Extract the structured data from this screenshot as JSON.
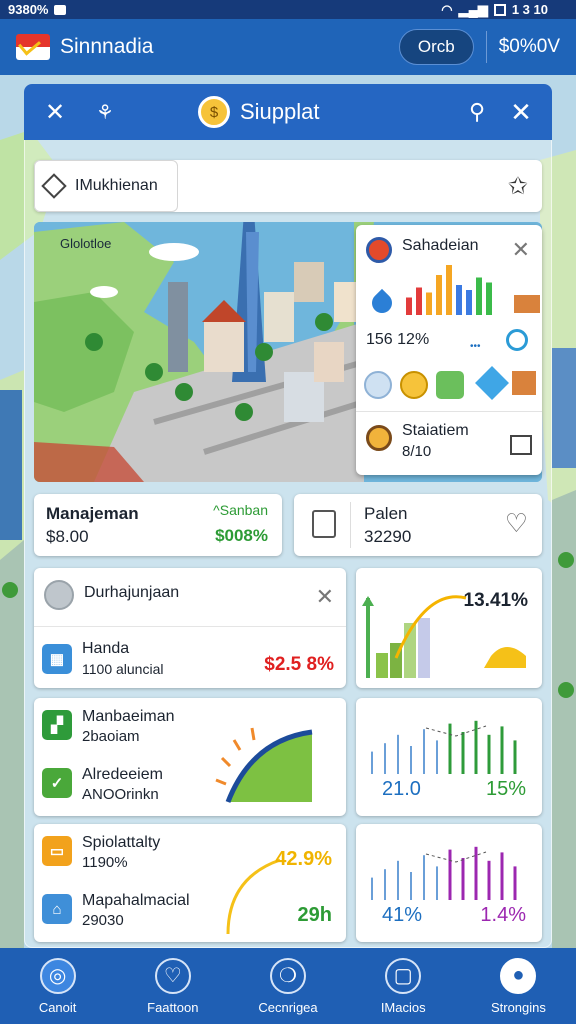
{
  "status_bar": {
    "left": "9380%",
    "right": "1 3 10"
  },
  "app_bar": {
    "title": "Sinnnadia",
    "pill": "Orcb",
    "balance": "$0%0V"
  },
  "panel": {
    "title": "Siupplat"
  },
  "search": {
    "tag": "IMukhienan"
  },
  "map": {
    "region_label": "Glolotloe"
  },
  "popup": {
    "title": "Sahadeian",
    "stat": "156 12%",
    "footer_title": "Staiatiem",
    "footer_value": "8/10",
    "bars": [
      {
        "h": 0.35,
        "color": "#e23b3b"
      },
      {
        "h": 0.55,
        "color": "#e23b3b"
      },
      {
        "h": 0.45,
        "color": "#f5a623"
      },
      {
        "h": 0.8,
        "color": "#f5a623"
      },
      {
        "h": 1.0,
        "color": "#f5a623"
      },
      {
        "h": 0.6,
        "color": "#3b7ae2"
      },
      {
        "h": 0.5,
        "color": "#3b7ae2"
      },
      {
        "h": 0.75,
        "color": "#3bbb4a"
      },
      {
        "h": 0.65,
        "color": "#3bbb4a"
      }
    ]
  },
  "cards": {
    "manage": {
      "title": "Manajeman",
      "value": "$8.00",
      "tag": "^Sanban",
      "percent": "$008%"
    },
    "palen": {
      "title": "Palen",
      "value": "32290"
    },
    "list": {
      "header": "Durhajunjaan",
      "item": {
        "name": "Handa",
        "sub": "1100 aluncial",
        "value": "$2.5 8%"
      }
    },
    "growth": {
      "percent": "13.41%"
    },
    "mid": {
      "a_title": "Manbaeiman",
      "a_sub": "2baoiam",
      "b_title": "Alredeeiem",
      "b_sub": "ANOOrinkn"
    },
    "chart1": {
      "v1": "21.0",
      "v2": "15%"
    },
    "bottom": {
      "a_title": "Spiolattalty",
      "a_sub": "1190%",
      "a_value": "42.9%",
      "b_title": "Mapahalmacial",
      "b_sub": "29030",
      "b_value": "29h"
    },
    "chart2": {
      "v1": "41%",
      "v2": "1.4%"
    }
  },
  "nav": [
    {
      "label": "Canoit",
      "icon": "compass-icon"
    },
    {
      "label": "Faattoon",
      "icon": "heart-icon"
    },
    {
      "label": "Cecnrigea",
      "icon": "chat-icon"
    },
    {
      "label": "IMacios",
      "icon": "message-icon"
    },
    {
      "label": "Strongins",
      "icon": "user-icon"
    }
  ],
  "colors": {
    "primary": "#1f64b8",
    "green": "#2d9b35",
    "red": "#e02020",
    "gold": "#f5c118"
  }
}
